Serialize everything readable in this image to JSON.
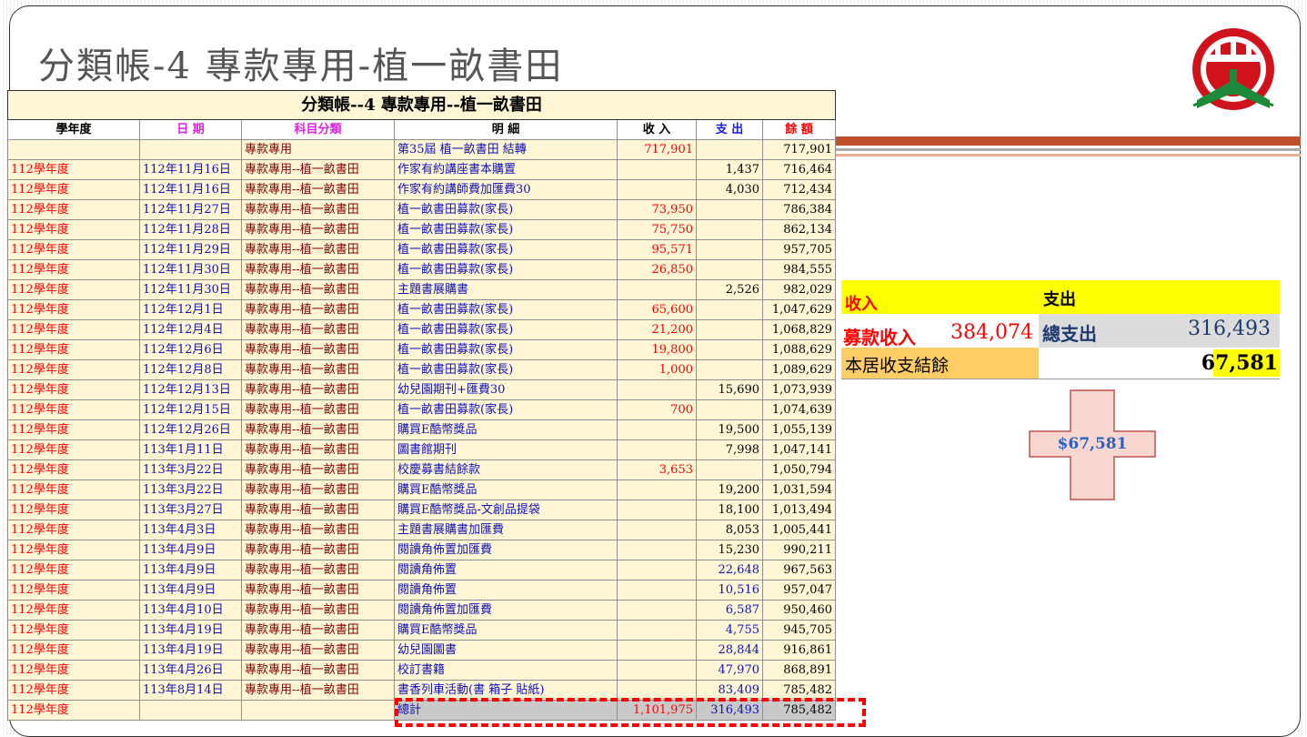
{
  "slide": {
    "title": "分類帳-4  專款專用-植一畝書田"
  },
  "logo": {
    "icon": "school-emblem-icon",
    "colors": [
      "#d0121b",
      "#1c8a3a",
      "#ffffff"
    ]
  },
  "ledger": {
    "table_title": "分類帳--4   專款專用--植一畝書田",
    "headers": {
      "year": "學年度",
      "date": "日 期",
      "category": "科目分類",
      "detail": "明  細",
      "income": "收 入",
      "expense": "支 出",
      "balance": "餘 額"
    },
    "rows": [
      {
        "year": "",
        "date": "",
        "category": "專款專用",
        "detail": "第35屆 植一畝書田 結轉",
        "income": "717,901",
        "expense": "",
        "balance": "717,901"
      },
      {
        "year": "112學年度",
        "date": "112年11月16日",
        "category": "專款專用--植一畝書田",
        "detail": "作家有約講座書本購置",
        "income": "",
        "expense": "1,437",
        "balance": "716,464"
      },
      {
        "year": "112學年度",
        "date": "112年11月16日",
        "category": "專款專用--植一畝書田",
        "detail": "作家有約講師費加匯費30",
        "income": "",
        "expense": "4,030",
        "balance": "712,434"
      },
      {
        "year": "112學年度",
        "date": "112年11月27日",
        "category": "專款專用--植一畝書田",
        "detail": "植一畝書田募款(家長)",
        "income": "73,950",
        "expense": "",
        "balance": "786,384"
      },
      {
        "year": "112學年度",
        "date": "112年11月28日",
        "category": "專款專用--植一畝書田",
        "detail": "植一畝書田募款(家長)",
        "income": "75,750",
        "expense": "",
        "balance": "862,134"
      },
      {
        "year": "112學年度",
        "date": "112年11月29日",
        "category": "專款專用--植一畝書田",
        "detail": "植一畝書田募款(家長)",
        "income": "95,571",
        "expense": "",
        "balance": "957,705"
      },
      {
        "year": "112學年度",
        "date": "112年11月30日",
        "category": "專款專用--植一畝書田",
        "detail": "植一畝書田募款(家長)",
        "income": "26,850",
        "expense": "",
        "balance": "984,555"
      },
      {
        "year": "112學年度",
        "date": "112年11月30日",
        "category": "專款專用--植一畝書田",
        "detail": "主題書展購書",
        "income": "",
        "expense": "2,526",
        "balance": "982,029"
      },
      {
        "year": "112學年度",
        "date": "112年12月1日",
        "category": "專款專用--植一畝書田",
        "detail": "植一畝書田募款(家長)",
        "income": "65,600",
        "expense": "",
        "balance": "1,047,629"
      },
      {
        "year": "112學年度",
        "date": "112年12月4日",
        "category": "專款專用--植一畝書田",
        "detail": "植一畝書田募款(家長)",
        "income": "21,200",
        "expense": "",
        "balance": "1,068,829"
      },
      {
        "year": "112學年度",
        "date": "112年12月6日",
        "category": "專款專用--植一畝書田",
        "detail": "植一畝書田募款(家長)",
        "income": "19,800",
        "expense": "",
        "balance": "1,088,629"
      },
      {
        "year": "112學年度",
        "date": "112年12月8日",
        "category": "專款專用--植一畝書田",
        "detail": "植一畝書田募款(家長)",
        "income": "1,000",
        "expense": "",
        "balance": "1,089,629"
      },
      {
        "year": "112學年度",
        "date": "112年12月13日",
        "category": "專款專用--植一畝書田",
        "detail": "幼兒園期刊+匯費30",
        "income": "",
        "expense": "15,690",
        "balance": "1,073,939"
      },
      {
        "year": "112學年度",
        "date": "112年12月15日",
        "category": "專款專用--植一畝書田",
        "detail": "植一畝書田募款(家長)",
        "income": "700",
        "expense": "",
        "balance": "1,074,639"
      },
      {
        "year": "112學年度",
        "date": "112年12月26日",
        "category": "專款專用--植一畝書田",
        "detail": "購買E酷幣獎品",
        "income": "",
        "expense": "19,500",
        "balance": "1,055,139"
      },
      {
        "year": "112學年度",
        "date": "113年1月11日",
        "category": "專款專用--植一畝書田",
        "detail": "圖書館期刊",
        "income": "",
        "expense": "7,998",
        "balance": "1,047,141"
      },
      {
        "year": "112學年度",
        "date": "113年3月22日",
        "category": "專款專用--植一畝書田",
        "detail": "校慶募書結餘款",
        "income": "3,653",
        "expense": "",
        "balance": "1,050,794"
      },
      {
        "year": "112學年度",
        "date": "113年3月22日",
        "category": "專款專用--植一畝書田",
        "detail": "購買E酷幣獎品",
        "income": "",
        "expense": "19,200",
        "balance": "1,031,594"
      },
      {
        "year": "112學年度",
        "date": "113年3月27日",
        "category": "專款專用--植一畝書田",
        "detail": "購買E酷幣獎品-文創品提袋",
        "income": "",
        "expense": "18,100",
        "balance": "1,013,494"
      },
      {
        "year": "112學年度",
        "date": "113年4月3日",
        "category": "專款專用--植一畝書田",
        "detail": "主題書展購書加匯費",
        "income": "",
        "expense": "8,053",
        "balance": "1,005,441"
      },
      {
        "year": "112學年度",
        "date": "113年4月9日",
        "category": "專款專用--植一畝書田",
        "detail": "閱讀角佈置加匯費",
        "income": "",
        "expense": "15,230",
        "balance": "990,211"
      },
      {
        "year": "112學年度",
        "date": "113年4月9日",
        "category": "專款專用--植一畝書田",
        "detail": "閱讀角佈置",
        "income": "",
        "expense": "22,648",
        "balance": "967,563"
      },
      {
        "year": "112學年度",
        "date": "113年4月9日",
        "category": "專款專用--植一畝書田",
        "detail": "閱讀角佈置",
        "income": "",
        "expense": "10,516",
        "balance": "957,047"
      },
      {
        "year": "112學年度",
        "date": "113年4月10日",
        "category": "專款專用--植一畝書田",
        "detail": "閱讀角佈置加匯費",
        "income": "",
        "expense": "6,587",
        "balance": "950,460"
      },
      {
        "year": "112學年度",
        "date": "113年4月19日",
        "category": "專款專用--植一畝書田",
        "detail": "購買E酷幣獎品",
        "income": "",
        "expense": "4,755",
        "balance": "945,705"
      },
      {
        "year": "112學年度",
        "date": "113年4月19日",
        "category": "專款專用--植一畝書田",
        "detail": "幼兒園圖書",
        "income": "",
        "expense": "28,844",
        "balance": "916,861"
      },
      {
        "year": "112學年度",
        "date": "113年4月26日",
        "category": "專款專用--植一畝書田",
        "detail": "校訂書籍",
        "income": "",
        "expense": "47,970",
        "balance": "868,891"
      },
      {
        "year": "112學年度",
        "date": "113年8月14日",
        "category": "專款專用--植一畝書田",
        "detail": "書香列車活動(書 箱子 貼紙)",
        "income": "",
        "expense": "83,409",
        "balance": "785,482"
      }
    ],
    "total": {
      "year": "112學年度",
      "detail": "總計",
      "income": "1,101,975",
      "expense": "316,493",
      "balance": "785,482"
    }
  },
  "summary": {
    "income_header": "收入",
    "expense_header": "支出",
    "income_label": "募款收入",
    "income_value": "384,074",
    "expense_label": "總支出",
    "expense_value": "316,493",
    "balance_label": "本居收支結餘",
    "balance_value": "67,581"
  },
  "plus_shape": {
    "label": "$67,581",
    "fill": "#f8d7d0",
    "stroke": "#c0504d"
  }
}
